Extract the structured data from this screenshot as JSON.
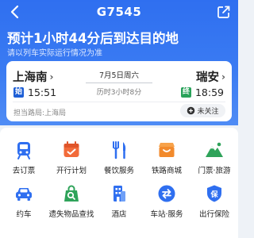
{
  "topbar": {
    "train_number": "G7545",
    "back_icon": "chevron-left-icon",
    "share_icon": "share-icon"
  },
  "headline": "预计1小时44分后到达目的地",
  "subline": "请以列车实际运行情况为准",
  "route": {
    "from": {
      "station": "上海南",
      "tag": "始",
      "time": "15:51"
    },
    "to": {
      "station": "瑞安",
      "tag": "终",
      "time": "18:59"
    },
    "date": "7月5日周六",
    "duration": "历时3小时8分",
    "bureau": "担当路局:上海局",
    "follow_label": "未关注"
  },
  "services": [
    {
      "label": "去订票",
      "icon": "train-ticket-icon"
    },
    {
      "label": "开行计划",
      "icon": "calendar-icon"
    },
    {
      "label": "餐饮服务",
      "icon": "fork-knife-icon"
    },
    {
      "label": "铁路商城",
      "icon": "shop-bag-icon"
    },
    {
      "label": "门票·旅游",
      "icon": "mountain-icon"
    },
    {
      "label": "约车",
      "icon": "car-icon"
    },
    {
      "label": "遗失物品查找",
      "icon": "lost-bag-icon"
    },
    {
      "label": "酒店",
      "icon": "hotel-building-icon"
    },
    {
      "label": "车站·服务",
      "icon": "swap-arrows-icon"
    },
    {
      "label": "出行保险",
      "icon": "insurance-shield-icon"
    }
  ],
  "colors": {
    "primary": "#2f6ff0",
    "start_tag": "#1e5fd6",
    "end_tag": "#29a25a",
    "orange": "#f28a2c",
    "green": "#2fa35a"
  }
}
